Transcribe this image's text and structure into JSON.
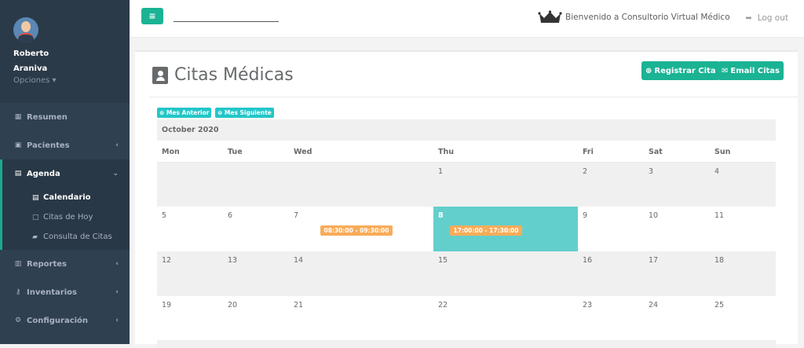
{
  "user": {
    "first_name": "Roberto",
    "last_name": "Araniva",
    "options_label": "Opciones ▾"
  },
  "sidebar": {
    "items": [
      {
        "label": "Resumen",
        "icon": "grid-icon"
      },
      {
        "label": "Pacientes",
        "icon": "id-card-icon"
      },
      {
        "label": "Agenda",
        "icon": "calendar-icon"
      },
      {
        "label": "Reportes",
        "icon": "table-icon"
      },
      {
        "label": "Inventarios",
        "icon": "sitemap-icon"
      },
      {
        "label": "Configuración",
        "icon": "cogs-icon"
      }
    ],
    "subitems": [
      {
        "label": "Calendario",
        "icon": "calendar-icon"
      },
      {
        "label": "Citas de Hoy",
        "icon": "calendar-o-icon"
      },
      {
        "label": "Consulta de Citas",
        "icon": "book-icon"
      }
    ]
  },
  "topbar": {
    "welcome": "Bienvenido a Consultorio Virtual Médico",
    "logout": "Log out"
  },
  "page": {
    "title": "Citas Médicas",
    "register_btn": "Registrar Cita",
    "email_btn": "Email Citas"
  },
  "calendar": {
    "prev_btn": "Mes Anterior",
    "next_btn": "Mes Siguiente",
    "month": "October 2020",
    "days": [
      "Mon",
      "Tue",
      "Wed",
      "Thu",
      "Fri",
      "Sat",
      "Sun"
    ],
    "weeks": [
      [
        "",
        "",
        "",
        "1",
        "2",
        "3",
        "4"
      ],
      [
        "5",
        "6",
        "7",
        "8",
        "9",
        "10",
        "11"
      ],
      [
        "12",
        "13",
        "14",
        "15",
        "16",
        "17",
        "18"
      ],
      [
        "19",
        "20",
        "21",
        "22",
        "23",
        "24",
        "25"
      ]
    ],
    "events": [
      {
        "day": "7",
        "time": "08:30:00 - 09:30:00"
      },
      {
        "day": "8",
        "time": "17:00:00 - 17:30:00"
      }
    ],
    "today": "8"
  },
  "colors": {
    "accent": "#1ab394",
    "today": "#63cfcd",
    "event": "#f8ac59",
    "sidebar": "#2f4050"
  }
}
